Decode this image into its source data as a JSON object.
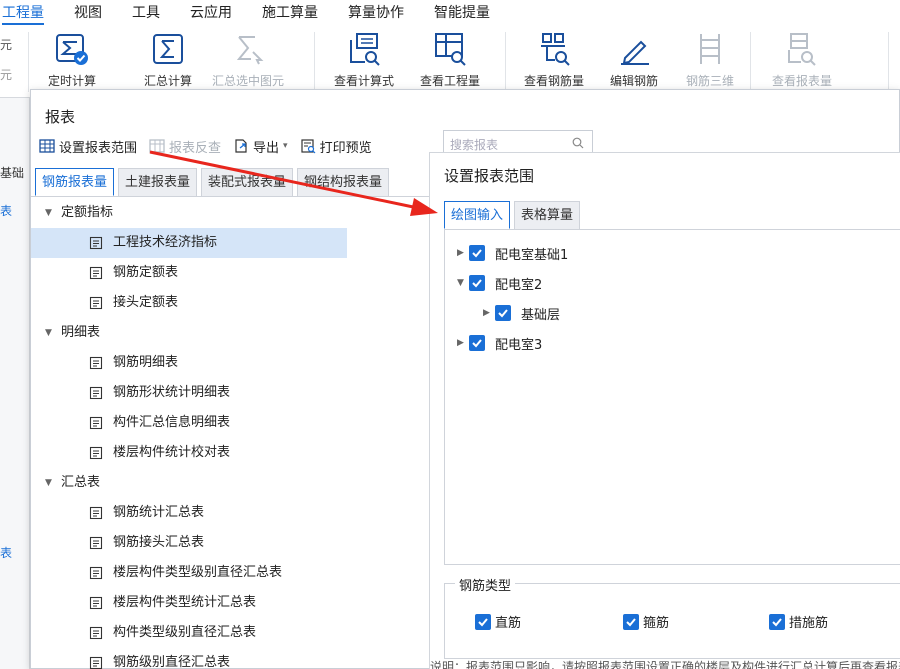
{
  "menu": {
    "items": [
      "工程量",
      "视图",
      "工具",
      "云应用",
      "施工算量",
      "算量协作",
      "智能提量"
    ],
    "active": "工程量"
  },
  "ribbon": {
    "left_stub": [
      "元",
      "元"
    ],
    "buttons": [
      {
        "label": "定时计算",
        "icon": "calc-check-icon"
      },
      {
        "label": "汇总计算",
        "icon": "sigma-icon"
      },
      {
        "label": "汇总选中图元",
        "icon": "sigma-arrow-icon",
        "disabled": true
      },
      {
        "label": "查看计算式",
        "icon": "formula-search-icon"
      },
      {
        "label": "查看工程量",
        "icon": "table-search-icon"
      },
      {
        "label": "查看钢筋量",
        "icon": "rebar-search-icon"
      },
      {
        "label": "编辑钢筋",
        "icon": "edit-pen-icon"
      },
      {
        "label": "钢筋三维",
        "icon": "rebar-3d-icon",
        "disabled": true
      },
      {
        "label": "查看报表量",
        "icon": "report-search-icon",
        "disabled": true
      }
    ]
  },
  "bg_left": [
    "基础",
    "表",
    "表"
  ],
  "dialog": {
    "title": "报表",
    "toolbar": {
      "set_range": "设置报表范围",
      "reverse": "报表反查",
      "export": "导出",
      "print_preview": "打印预览"
    },
    "search_placeholder": "搜索报表",
    "tabs": [
      "钢筋报表量",
      "土建报表量",
      "装配式报表量",
      "钢结构报表量"
    ],
    "active_tab": "钢筋报表量",
    "tree": [
      {
        "group": "定额指标",
        "items": [
          "工程技术经济指标",
          "钢筋定额表",
          "接头定额表"
        ]
      },
      {
        "group": "明细表",
        "items": [
          "钢筋明细表",
          "钢筋形状统计明细表",
          "构件汇总信息明细表",
          "楼层构件统计校对表"
        ]
      },
      {
        "group": "汇总表",
        "items": [
          "钢筋统计汇总表",
          "钢筋接头汇总表",
          "楼层构件类型级别直径汇总表",
          "楼层构件类型统计汇总表",
          "构件类型级别直径汇总表",
          "钢筋级别直径汇总表"
        ]
      }
    ],
    "selected_item": "工程技术经济指标"
  },
  "range_panel": {
    "title": "设置报表范围",
    "tabs": [
      "绘图输入",
      "表格算量"
    ],
    "active_tab": "绘图输入",
    "nodes": [
      {
        "label": "配电室基础1",
        "expanded": false,
        "checked": true
      },
      {
        "label": "配电室2",
        "expanded": true,
        "checked": true
      },
      {
        "label": "基础层",
        "expanded": false,
        "checked": true
      },
      {
        "label": "配电室3",
        "expanded": false,
        "checked": true
      }
    ],
    "rebar_type": {
      "legend": "钢筋类型",
      "options": [
        "直筋",
        "箍筋",
        "措施筋"
      ]
    },
    "footer_note": "说明：报表范围只影响，请按照报表范围设置正确的楼层及构件进行汇总计算后再查看报表"
  },
  "colors": {
    "accent": "#1a6fd6",
    "arrow": "#e8261d",
    "selected_row": "#d5e5f8"
  }
}
